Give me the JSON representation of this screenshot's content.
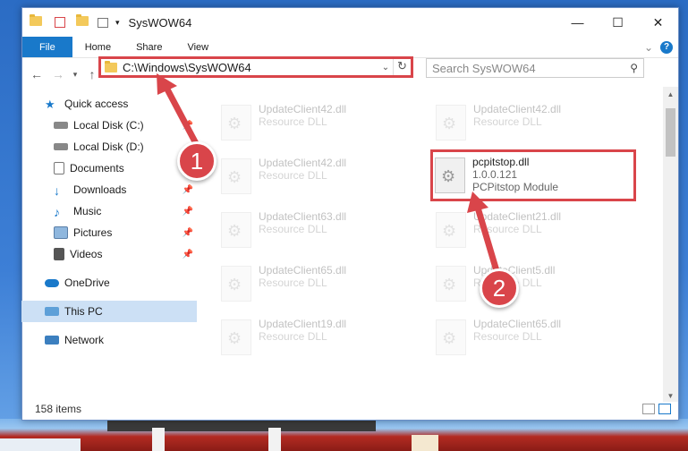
{
  "window": {
    "title": "SysWOW64"
  },
  "ribbon": {
    "tabs": [
      "File",
      "Home",
      "Share",
      "View"
    ]
  },
  "address": {
    "path": "C:\\Windows\\SysWOW64"
  },
  "search": {
    "placeholder": "Search SysWOW64"
  },
  "sidebar": {
    "items": [
      {
        "label": "Quick access",
        "icon": "star-icon",
        "pinned": false
      },
      {
        "label": "Local Disk (C:)",
        "icon": "drive-icon",
        "pinned": true
      },
      {
        "label": "Local Disk (D:)",
        "icon": "drive-icon",
        "pinned": false
      },
      {
        "label": "Documents",
        "icon": "documents-icon",
        "pinned": true
      },
      {
        "label": "Downloads",
        "icon": "download-icon",
        "pinned": true
      },
      {
        "label": "Music",
        "icon": "music-icon",
        "pinned": true
      },
      {
        "label": "Pictures",
        "icon": "pictures-icon",
        "pinned": true
      },
      {
        "label": "Videos",
        "icon": "videos-icon",
        "pinned": true
      },
      {
        "label": "OneDrive",
        "icon": "cloud-icon",
        "pinned": false
      },
      {
        "label": "This PC",
        "icon": "computer-icon",
        "pinned": false
      },
      {
        "label": "Network",
        "icon": "network-icon",
        "pinned": false
      }
    ]
  },
  "files": [
    {
      "name": "UpdateClient42.dll",
      "type": "Resource DLL"
    },
    {
      "name": "UpdateClient42.dll",
      "type": "Resource DLL"
    },
    {
      "name": "UpdateClient42.dll",
      "type": "Resource DLL"
    },
    {
      "name": "pcpitstop.dll",
      "version": "1.0.0.121",
      "type": "PCPitstop Module"
    },
    {
      "name": "UpdateClient63.dll",
      "type": "Resource DLL"
    },
    {
      "name": "UpdateClient21.dll",
      "type": "Resource DLL"
    },
    {
      "name": "UpdateClient65.dll",
      "type": "Resource DLL"
    },
    {
      "name": "UpdateClient5.dll",
      "type": "Resource DLL"
    },
    {
      "name": "UpdateClient19.dll",
      "type": "Resource DLL"
    },
    {
      "name": "UpdateClient65.dll",
      "type": "Resource DLL"
    }
  ],
  "status": {
    "item_count": "158 items"
  },
  "callouts": [
    "1",
    "2"
  ],
  "colors": {
    "accent": "#1979ca",
    "annotation": "#d9454a"
  }
}
